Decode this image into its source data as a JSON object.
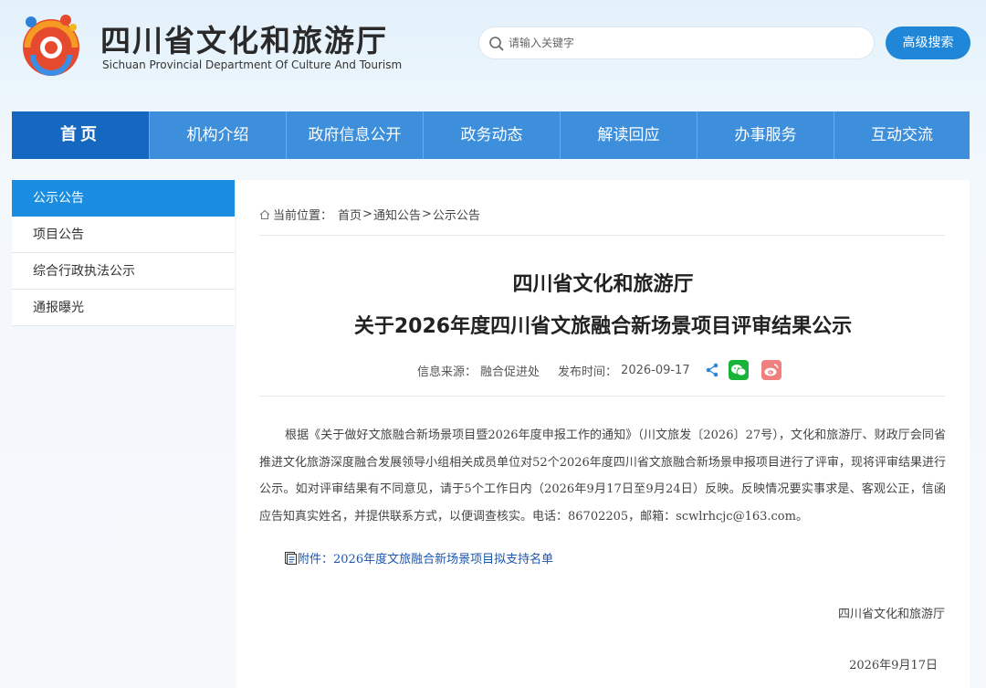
{
  "header": {
    "title": "四川省文化和旅游厅",
    "subtitle": "Sichuan Provincial Department Of Culture And Tourism",
    "logo_icon": "sichuan-culture-tourism-logo"
  },
  "search": {
    "placeholder": "请输入关键字",
    "advanced_label": "高级搜索"
  },
  "nav": {
    "items": [
      "首页",
      "机构介绍",
      "政府信息公开",
      "政务动态",
      "解读回应",
      "办事服务",
      "互动交流"
    ]
  },
  "sidebar": {
    "items": [
      "公示公告",
      "项目公告",
      "综合行政执法公示",
      "通报曝光"
    ],
    "active_index": 0
  },
  "breadcrumb": {
    "prefix": "当前位置：",
    "items": [
      "首页",
      "通知公告",
      "公示公告"
    ],
    "separator": ">"
  },
  "article": {
    "title_line1": "四川省文化和旅游厅",
    "title_line2": "关于2026年度四川省文旅融合新场景项目评审结果公示",
    "source_label": "信息来源：",
    "source": "融合促进处",
    "time_label": "发布时间：",
    "time": "2026-09-17",
    "body": "根据《关于做好文旅融合新场景项目暨2026年度申报工作的通知》（川文旅发〔2026〕27号），文化和旅游厅、财政厅会同省推进文化旅游深度融合发展领导小组相关成员单位对52个2026年度四川省文旅融合新场景申报项目进行了评审，现将评审结果进行公示。如对评审结果有不同意见，请于5个工作日内（2026年9月17日至9月24日）反映。反映情况要实事求是、客观公正，信函应告知真实姓名，并提供联系方式，以便调查核实。电话：86702205，邮箱：scwlrhcjc@163.com。",
    "attachment": "附件：2026年度文旅融合新场景项目拟支持名单",
    "signature_org": "四川省文化和旅游厅",
    "signature_date": "2026年9月17日"
  },
  "colors": {
    "nav_bg": "#3d8fdc",
    "nav_active": "#1567c0",
    "sidebar_active": "#1a8de0",
    "button": "#1f86d8",
    "wechat": "#1ab33a",
    "weibo": "#f0807f"
  }
}
